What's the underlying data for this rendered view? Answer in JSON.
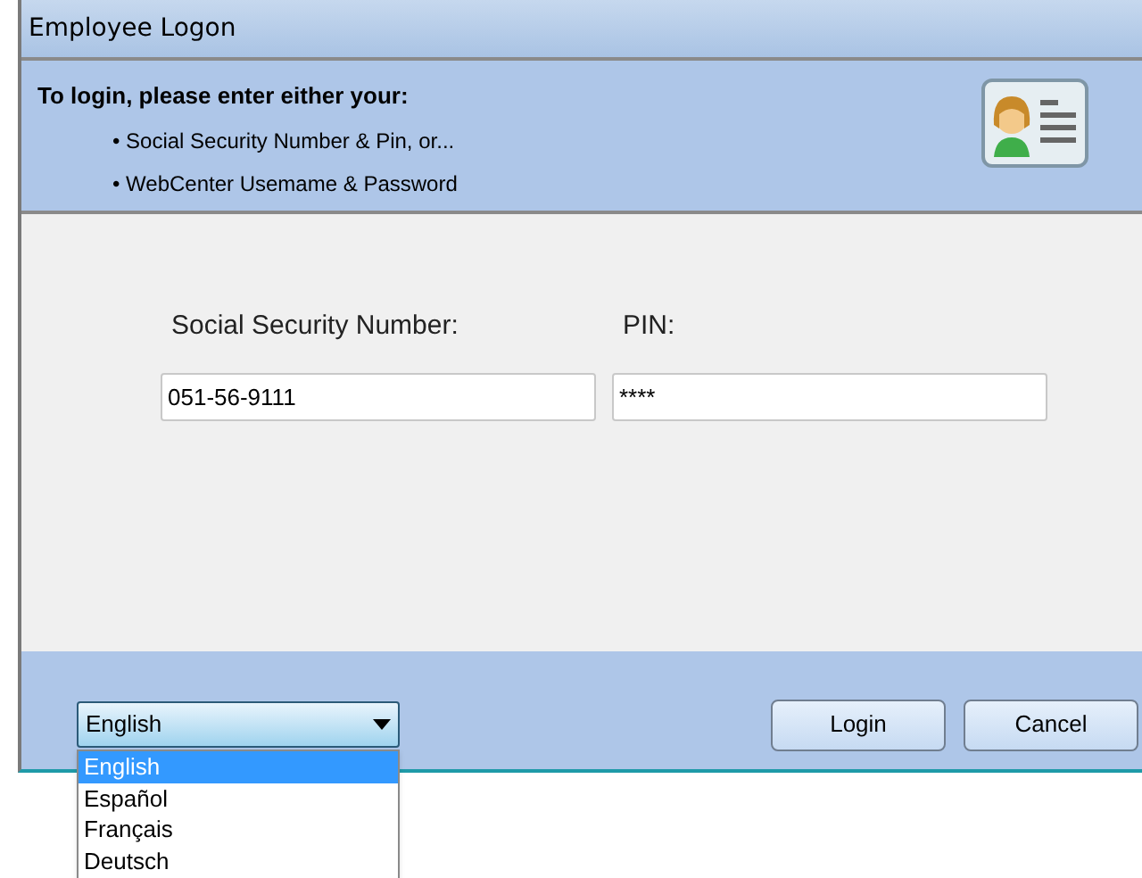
{
  "window": {
    "title": "Employee Logon"
  },
  "header": {
    "heading": "To login, please enter either your:",
    "bullets": [
      "• Social Security Number & Pin, or...",
      "• WebCenter Usemame & Password"
    ]
  },
  "fields": [
    {
      "label": "Social Security Number:",
      "value": "051-56-9111"
    },
    {
      "label": "PIN:",
      "value": "****"
    }
  ],
  "language": {
    "value": "English",
    "expanded": true,
    "options": [
      {
        "label": "English",
        "selected": true
      },
      {
        "label": "Español",
        "selected": false
      },
      {
        "label": "Français",
        "selected": false
      },
      {
        "label": "Deutsch",
        "selected": false
      }
    ]
  },
  "buttons": [
    "Login",
    "Cancel"
  ]
}
